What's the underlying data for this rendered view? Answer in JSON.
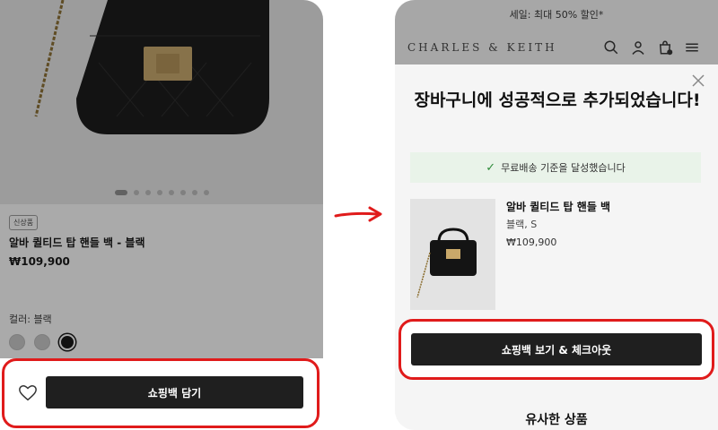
{
  "left": {
    "badge": "신상품",
    "product_title": "알바 퀼티드 탑 핸들 백 - 블랙",
    "price": "₩109,900",
    "color_label": "컬러: 블랙",
    "add_to_bag_label": "쇼핑백 담기",
    "carousel_dots": 8,
    "carousel_active": 1
  },
  "right": {
    "banner": "세일: 최대 50% 할인*",
    "logo": "CHARLES & KEITH",
    "modal": {
      "title": "장바구니에 성공적으로 추가되었습니다!",
      "success_text": "무료배송 기준을 달성했습니다",
      "product_name": "알바 퀼티드 탑 핸들 백",
      "variant": "블랙, S",
      "price": "₩109,900",
      "checkout_label": "쇼핑백 보기 & 체크아웃",
      "similar_heading": "유사한 상품"
    }
  },
  "colors": {
    "highlight": "#e01b1b",
    "button": "#1f1f1f",
    "success_bg": "#e9f3e9"
  }
}
